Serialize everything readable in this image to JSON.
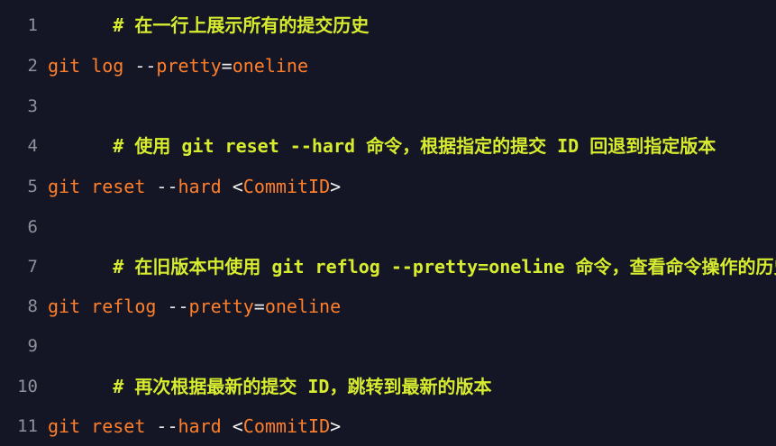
{
  "colors": {
    "background": "#141625",
    "line_number": "#8f929c",
    "comment": "#d7ec2e",
    "keyword": "#ff7f2a",
    "operator": "#e8e8e8"
  },
  "lines": [
    {
      "num": "1",
      "text": "# 在一行上展示所有的提交历史"
    },
    {
      "num": "2",
      "cmd": "git log ",
      "dash": "--",
      "opt": "pretty",
      "eq": "=",
      "val": "oneline"
    },
    {
      "num": "3"
    },
    {
      "num": "4",
      "text": "# 使用 git reset --hard 命令，根据指定的提交 ID 回退到指定版本"
    },
    {
      "num": "5",
      "cmd": "git reset ",
      "dash": "--",
      "opt": "hard",
      "sp": " ",
      "lt": "<",
      "arg": "CommitID",
      "gt": ">"
    },
    {
      "num": "6"
    },
    {
      "num": "7",
      "text": "# 在旧版本中使用 git reflog --pretty=oneline 命令，查看命令操作的历史"
    },
    {
      "num": "8",
      "cmd": "git reflog ",
      "dash": "--",
      "opt": "pretty",
      "eq": "=",
      "val": "oneline"
    },
    {
      "num": "9"
    },
    {
      "num": "10",
      "text": "# 再次根据最新的提交 ID，跳转到最新的版本"
    },
    {
      "num": "11",
      "cmd": "git reset ",
      "dash": "--",
      "opt": "hard",
      "sp": " ",
      "lt": "<",
      "arg": "CommitID",
      "gt": ">"
    }
  ]
}
